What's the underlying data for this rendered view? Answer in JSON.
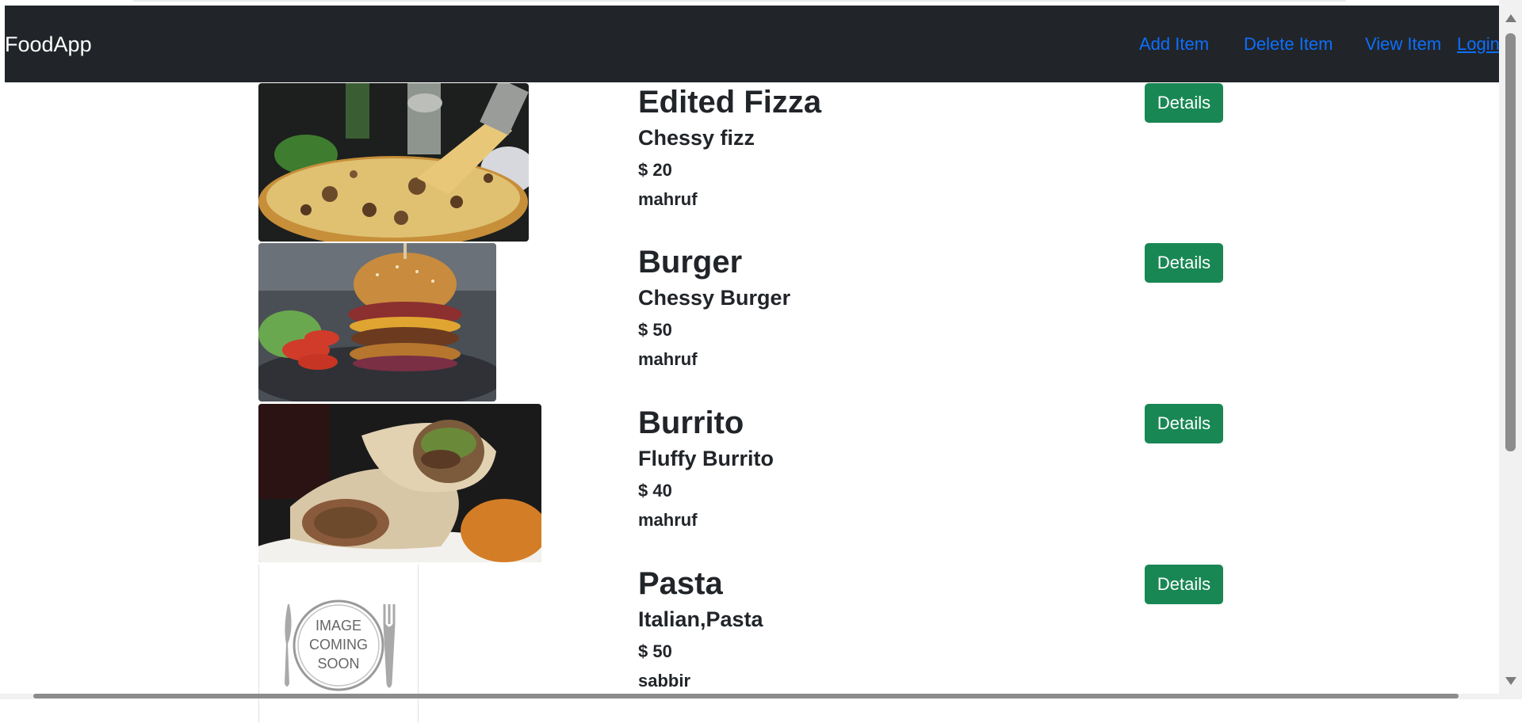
{
  "navbar": {
    "brand": "FoodApp",
    "links": [
      "Add Item",
      "Delete Item",
      "View Item",
      "Login"
    ]
  },
  "items": [
    {
      "title": "Edited Fizza",
      "subtitle": "Chessy fizz",
      "price": "$ 20",
      "owner": "mahruf",
      "button": "Details",
      "image": "pizza-image"
    },
    {
      "title": "Burger",
      "subtitle": "Chessy Burger",
      "price": "$ 50",
      "owner": "mahruf",
      "button": "Details",
      "image": "burger-image"
    },
    {
      "title": "Burrito",
      "subtitle": "Fluffy Burrito",
      "price": "$ 40",
      "owner": "mahruf",
      "button": "Details",
      "image": "burrito-image"
    },
    {
      "title": "Pasta",
      "subtitle": "Italian,Pasta",
      "price": "$ 50",
      "owner": "sabbir",
      "button": "Details",
      "image": "image-coming-soon"
    }
  ],
  "placeholder_text": [
    "IMAGE",
    "COMING",
    "SOON"
  ],
  "colors": {
    "navbar_bg": "#212529",
    "link": "#0d6efd",
    "button": "#198754"
  }
}
